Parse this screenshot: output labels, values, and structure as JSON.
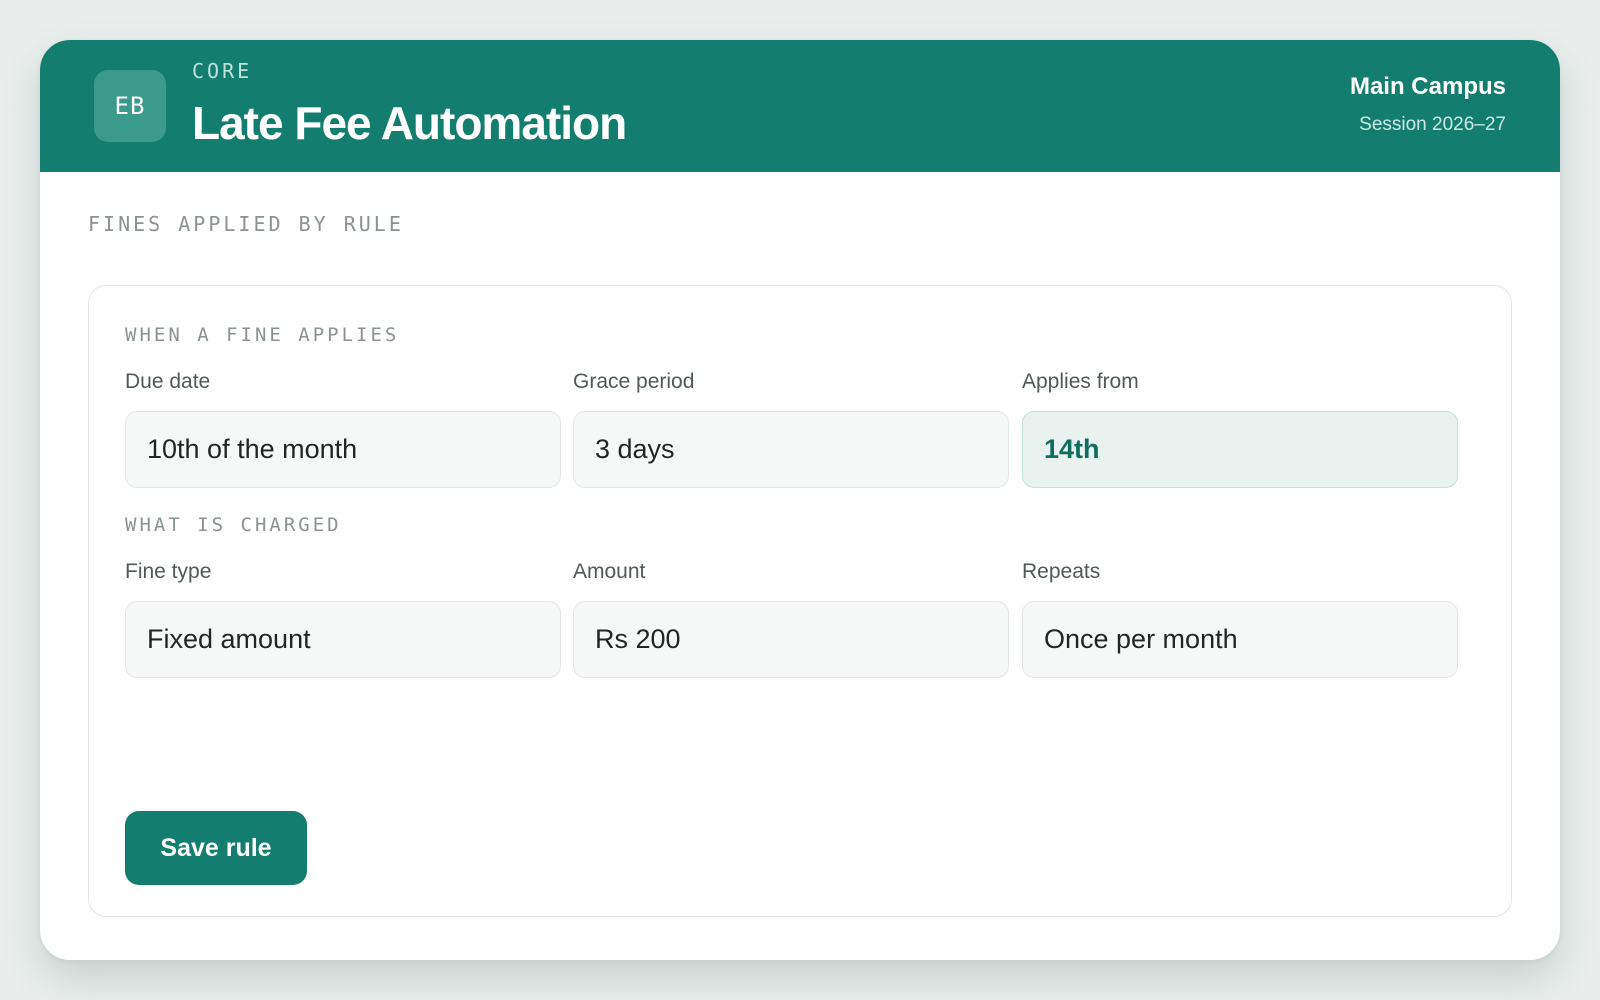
{
  "header": {
    "logo_initials": "EB",
    "eyebrow": "CORE",
    "title": "Late Fee Automation",
    "campus": "Main Campus",
    "session": "Session 2026–27"
  },
  "main": {
    "section_label": "FINES APPLIED BY RULE",
    "when_group": {
      "label": "WHEN A FINE APPLIES",
      "fields": [
        {
          "label": "Due date",
          "value": "10th of the month"
        },
        {
          "label": "Grace period",
          "value": "3 days"
        },
        {
          "label": "Applies from",
          "value": "14th"
        }
      ]
    },
    "charge_group": {
      "label": "WHAT IS CHARGED",
      "fields": [
        {
          "label": "Fine type",
          "value": "Fixed amount"
        },
        {
          "label": "Amount",
          "value": "Rs 200"
        },
        {
          "label": "Repeats",
          "value": "Once per month"
        }
      ]
    },
    "save_label": "Save rule"
  },
  "colors": {
    "brand": "#137e6f",
    "highlight_bg": "#e8f3f0",
    "highlight_text": "#126c5e"
  }
}
